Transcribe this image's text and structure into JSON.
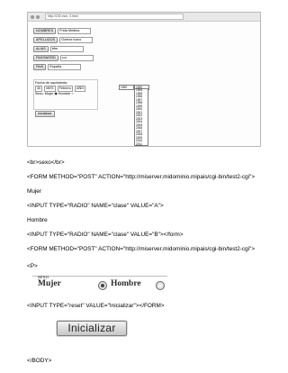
{
  "browser_screenshot": {
    "url": "http://192.mov: 3.html",
    "rows": [
      {
        "label": "NOMBRES",
        "value": "Frida Medina"
      },
      {
        "label": "APELLIDOS",
        "value": "Gomez lozco"
      },
      {
        "label": "ALIAS",
        "value": "bfm"
      },
      {
        "label": "PASSWORD",
        "value": "••••"
      },
      {
        "label": "PAIS",
        "value": "España"
      }
    ],
    "date_label": "Fecha de nacimiento:",
    "date_day": "30",
    "date_month": "MES",
    "date_month_name": "Febrero",
    "date_year_label": "AÑO",
    "sexo_label": "Sexo:",
    "sexo_mujer": "Mujer",
    "sexo_hombre": "Hombre",
    "clear_button": "inicializar",
    "year_selected": "1990",
    "year_options": [
      "1994",
      "1995",
      "1996",
      "1997",
      "1998",
      "1999",
      "2000",
      "2001",
      "2002",
      "2003",
      "2004",
      "2005",
      "2006",
      "2007",
      "2008",
      "2009",
      "2010",
      "2011",
      "2012"
    ]
  },
  "document_lines": [
    "<br>sexo</br>",
    "<FORM METHOD=\"POST\" ACTION=\"http://miserver.midominio.mipais/cgi-bin/test2-cgi\">",
    "Mujer",
    "<INPUT TYPE=\"RADIO\" NAME=\"clase\" VALUE=\"A\">",
    "Hombre",
    "<INPUT TYPE=\"RADIO\" NAME=\"clase\" VALUE=\"B\"></form>",
    "<FORM METHOD=\"POST\" ACTION=\"http://miserver.midominio.mipais/cgi-bin/test2-cgi\">",
    "<P>",
    "<INPUT TYPE=\"reset\" VALUE=\"Inicializar\"></FORM>",
    "</BODY>"
  ],
  "sexo_image": {
    "title": "sexo",
    "mujer": "Mujer",
    "hombre": "Hombre"
  },
  "reset_image": {
    "label": "Inicializar"
  }
}
